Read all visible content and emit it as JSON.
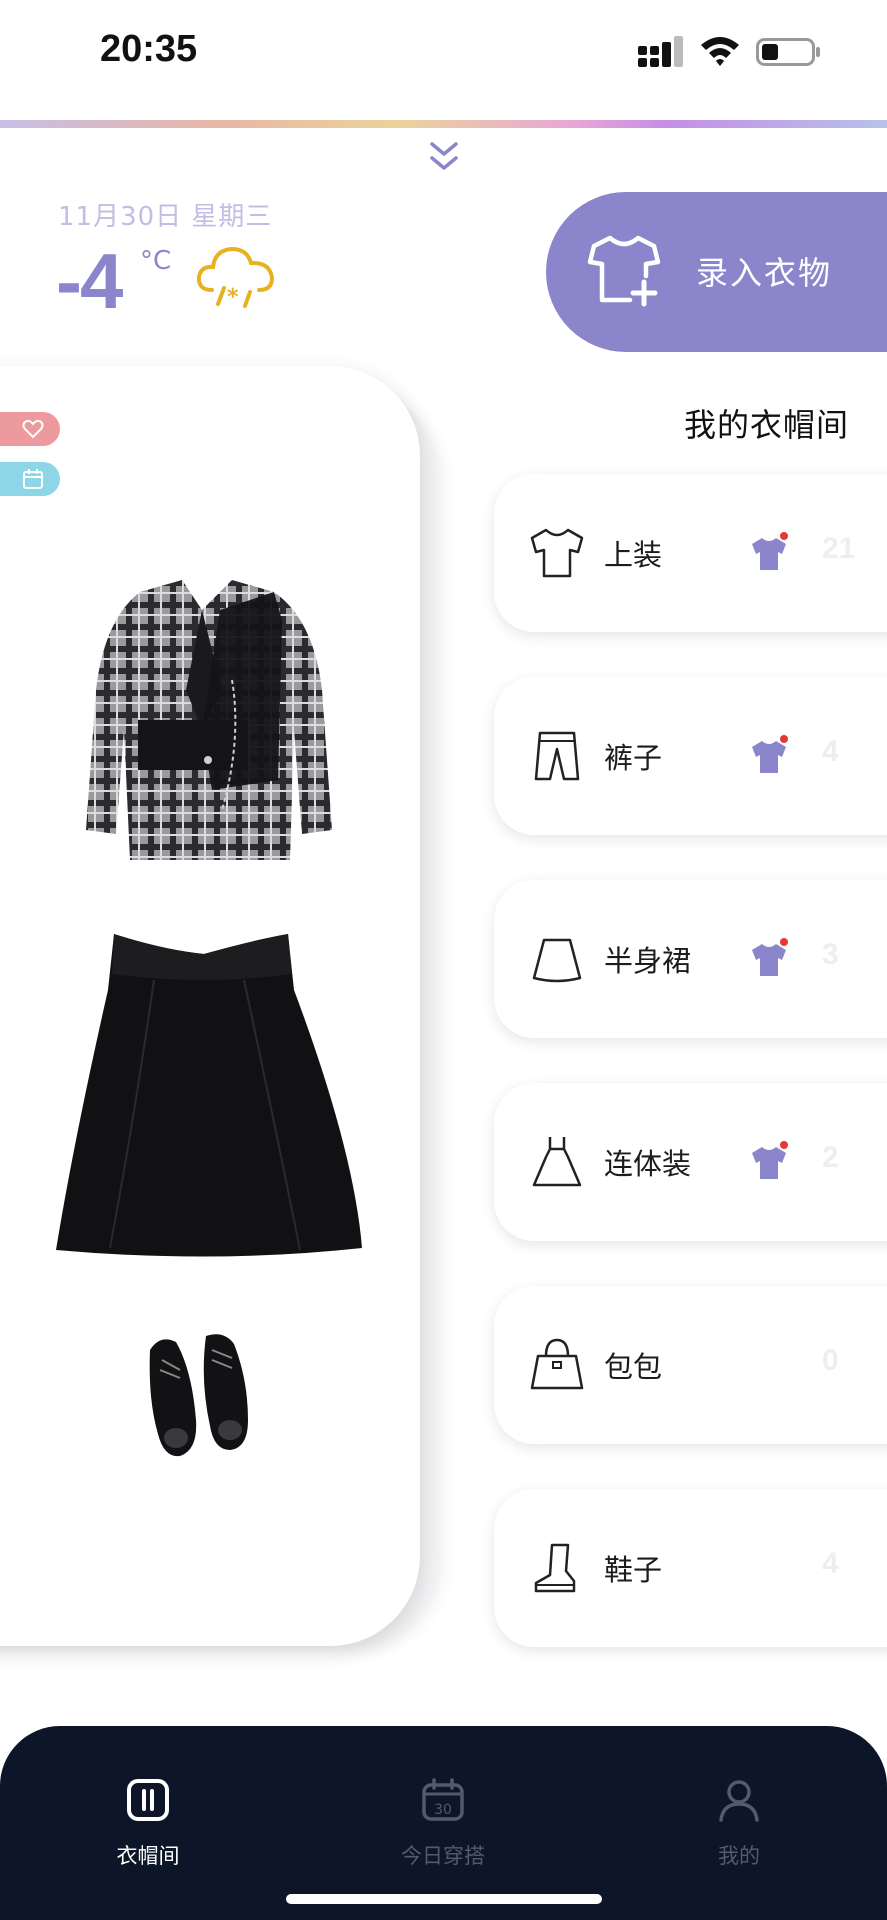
{
  "status_bar": {
    "time": "20:35",
    "signal_icon": "signal-dots-icon",
    "wifi_icon": "wifi-icon",
    "battery_icon": "battery-icon"
  },
  "weather": {
    "date": "11月30日 星期三",
    "temperature": "-4",
    "unit": "°C",
    "condition_icon": "snow-cloud-icon"
  },
  "add_button": {
    "label": "录入衣物",
    "icon": "shirt-plus-icon"
  },
  "outfit": {
    "tags": [
      "heart-tag-icon",
      "calendar-tag-icon"
    ],
    "items": [
      "plaid-jacket",
      "black-skirt",
      "black-shoes"
    ]
  },
  "wardrobe": {
    "title": "我的衣帽间",
    "categories": [
      {
        "label": "上装",
        "count": "21",
        "icon": "tshirt-icon"
      },
      {
        "label": "裤子",
        "count": "4",
        "icon": "pants-icon"
      },
      {
        "label": "半身裙",
        "count": "3",
        "icon": "skirt-icon"
      },
      {
        "label": "连体装",
        "count": "2",
        "icon": "dress-icon"
      },
      {
        "label": "包包",
        "count": "0",
        "icon": "bag-icon"
      },
      {
        "label": "鞋子",
        "count": "4",
        "icon": "boot-icon"
      }
    ]
  },
  "tab_bar": {
    "tabs": [
      {
        "label": "衣帽间",
        "icon": "wardrobe-icon",
        "active": true
      },
      {
        "label": "今日穿搭",
        "icon": "calendar-30-icon",
        "active": false,
        "icon_text": "30"
      },
      {
        "label": "我的",
        "icon": "person-icon",
        "active": false
      }
    ]
  },
  "colors": {
    "accent": "#8b86cc",
    "tab_bar_bg": "#0d1628",
    "heart_tag": "#ec9a9d",
    "calendar_tag": "#8dd6e8"
  }
}
